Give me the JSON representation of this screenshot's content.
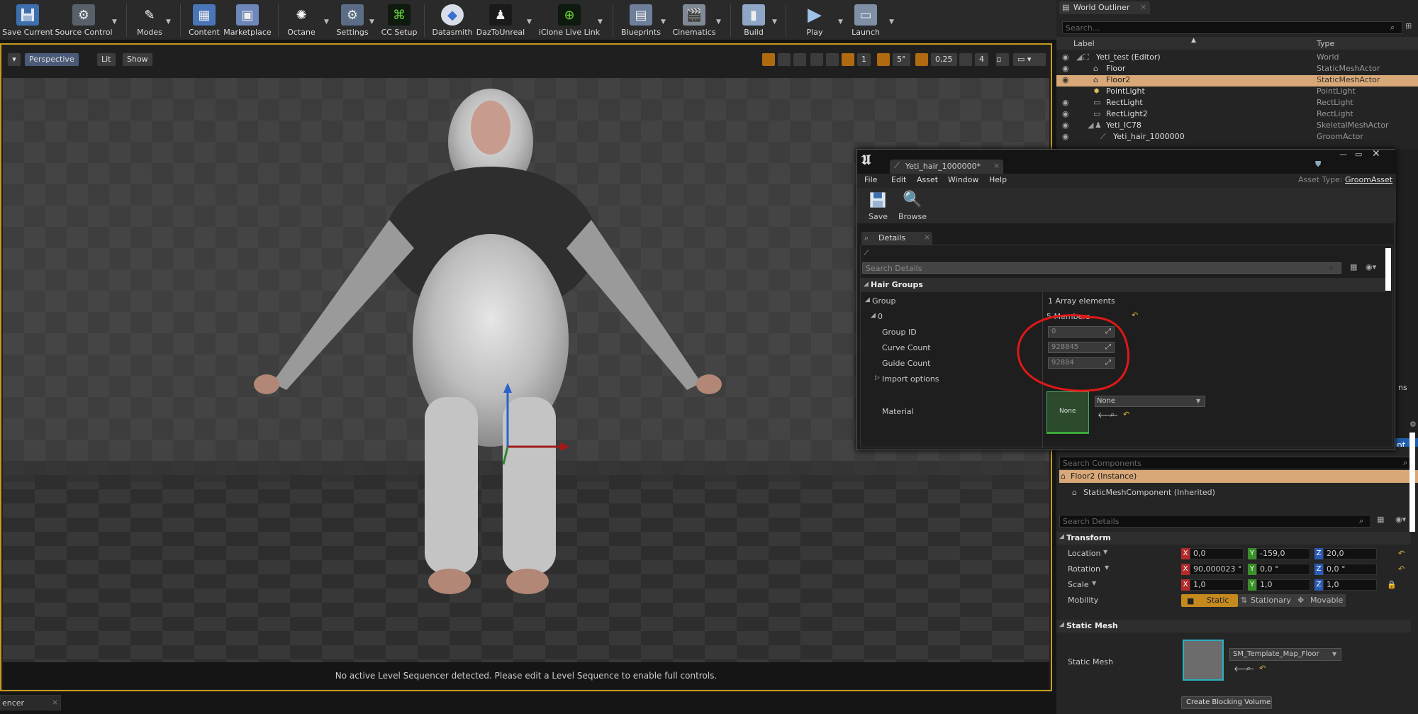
{
  "toolbar": {
    "items": [
      {
        "label": "Save Current",
        "icon": "save-icon"
      },
      {
        "label": "Source Control",
        "icon": "source-control-icon"
      },
      {
        "label": "Modes",
        "icon": "modes-icon"
      },
      {
        "label": "Content",
        "icon": "content-icon"
      },
      {
        "label": "Marketplace",
        "icon": "marketplace-icon"
      },
      {
        "label": "Octane",
        "icon": "octane-icon"
      },
      {
        "label": "Settings",
        "icon": "settings-icon"
      },
      {
        "label": "CC Setup",
        "icon": "cc-setup-icon"
      },
      {
        "label": "Datasmith",
        "icon": "datasmith-icon"
      },
      {
        "label": "DazToUnreal",
        "icon": "daz-icon"
      },
      {
        "label": "iClone Live Link",
        "icon": "iclone-icon"
      },
      {
        "label": "Blueprints",
        "icon": "blueprints-icon"
      },
      {
        "label": "Cinematics",
        "icon": "cinematics-icon"
      },
      {
        "label": "Build",
        "icon": "build-icon"
      },
      {
        "label": "Play",
        "icon": "play-icon"
      },
      {
        "label": "Launch",
        "icon": "launch-icon"
      }
    ]
  },
  "viewport": {
    "perspective": "Perspective",
    "lit": "Lit",
    "show": "Show",
    "snap_rot": "5°",
    "snap_scale": "0,25",
    "cam_speed": "4",
    "grid_num": "1",
    "status": "No active Level Sequencer detected. Please edit a Level Sequence to enable full controls."
  },
  "sequencer_tab": "encer",
  "outliner": {
    "title": "World Outliner",
    "search_placeholder": "Search...",
    "col_label": "Label",
    "col_type": "Type",
    "rows": [
      {
        "label": "Yeti_test (Editor)",
        "type": "World"
      },
      {
        "label": "Floor",
        "type": "StaticMeshActor"
      },
      {
        "label": "Floor2",
        "type": "StaticMeshActor"
      },
      {
        "label": "PointLight",
        "type": "PointLight"
      },
      {
        "label": "RectLight",
        "type": "RectLight"
      },
      {
        "label": "RectLight2",
        "type": "RectLight"
      },
      {
        "label": "Yeti_IC78",
        "type": "SkeletalMeshActor"
      },
      {
        "label": "Yeti_hair_1000000",
        "type": "GroomActor"
      }
    ]
  },
  "groom": {
    "tab": "Yeti_hair_1000000*",
    "menu": [
      "File",
      "Edit",
      "Asset",
      "Window",
      "Help"
    ],
    "asset_type_label": "Asset Type:",
    "asset_type": "GroomAsset",
    "save": "Save",
    "browse": "Browse",
    "details_tab": "Details",
    "search_placeholder": "Search Details",
    "section": "Hair Groups",
    "group_label": "Group",
    "group_value": "1 Array elements",
    "index": "0",
    "members": "5 Members",
    "group_id_label": "Group ID",
    "group_id": "0",
    "curve_count_label": "Curve Count",
    "curve_count": "928845",
    "guide_count_label": "Guide Count",
    "guide_count": "92884",
    "import_options": "Import options",
    "material_label": "Material",
    "material_value": "None",
    "material_thumb": "None"
  },
  "components": {
    "search_placeholder": "Search Components",
    "instance": "Floor2 (Instance)",
    "component": "StaticMeshComponent (Inherited)"
  },
  "details": {
    "search_placeholder": "Search Details",
    "transform": "Transform",
    "location_label": "Location",
    "loc_x": "0,0",
    "loc_y": "-159,0",
    "loc_z": "20,0",
    "rotation_label": "Rotation",
    "rot_x": "90,000023 °",
    "rot_y": "0,0 °",
    "rot_z": "0,0 °",
    "scale_label": "Scale",
    "scale_x": "1,0",
    "scale_y": "1,0",
    "scale_z": "1,0",
    "mobility_label": "Mobility",
    "mob_static": "Static",
    "mob_stationary": "Stationary",
    "mob_movable": "Movable",
    "static_mesh_section": "Static Mesh",
    "static_mesh_label": "Static Mesh",
    "static_mesh_value": "SM_Template_Map_Floor",
    "blocking_volume": "Create Blocking Volume",
    "side_fragment": "ns",
    "side_fragment2": "pt"
  }
}
